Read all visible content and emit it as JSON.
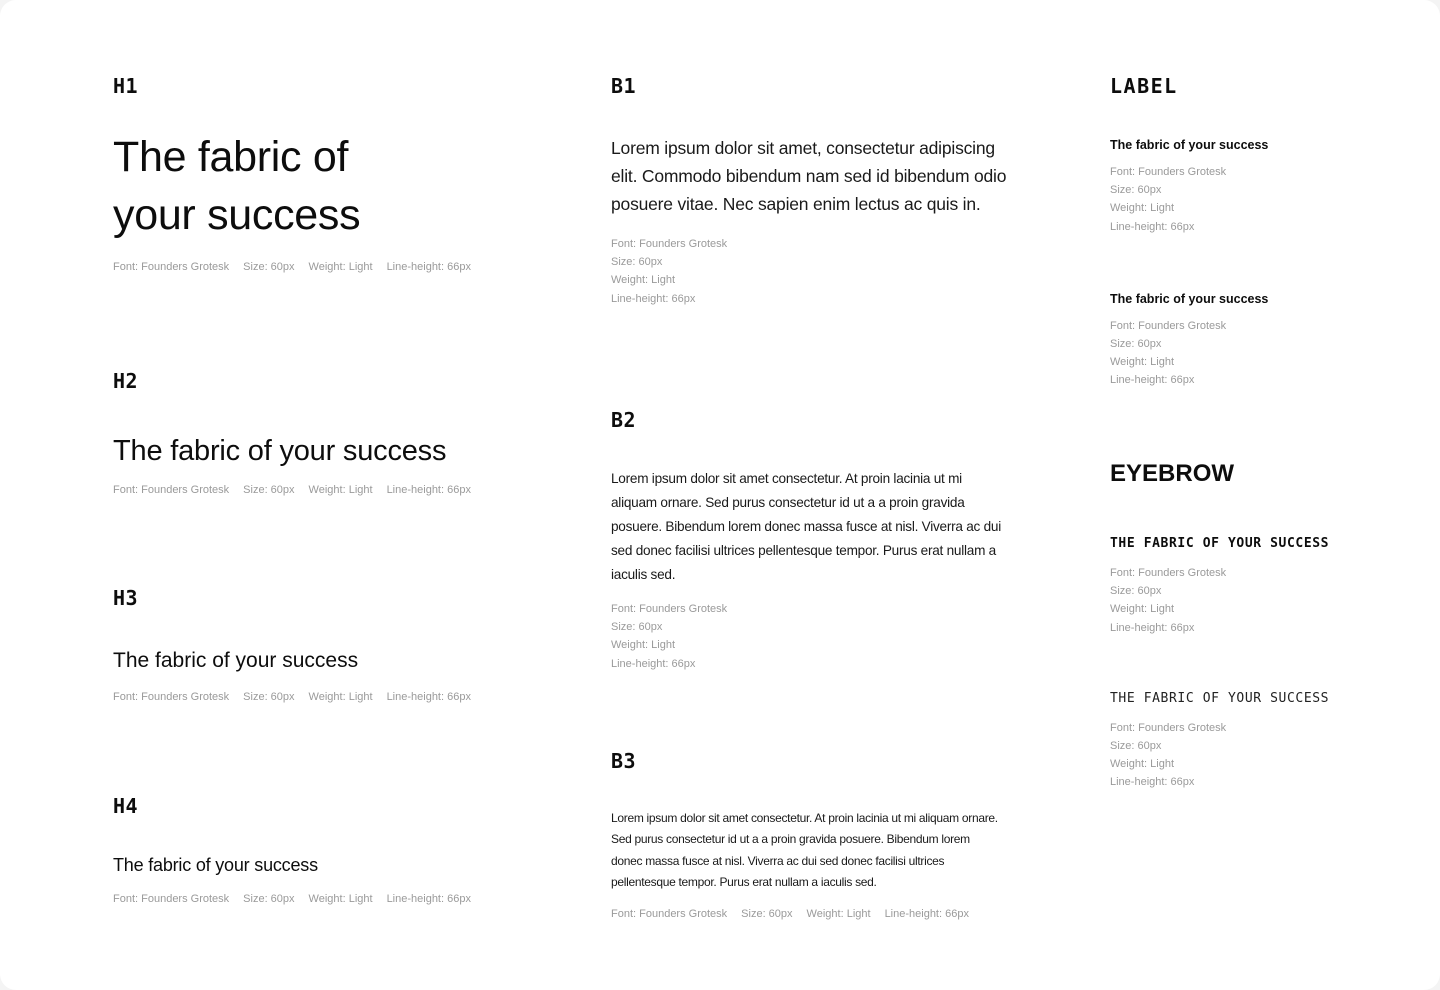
{
  "columns": {
    "headings": {
      "h1": {
        "label": "H1",
        "sample": "The  fabric of your success",
        "meta": [
          "Font:  Founders Grotesk",
          "Size:  60px",
          "Weight:  Light",
          "Line-height:  66px"
        ]
      },
      "h2": {
        "label": "H2",
        "sample": "The  fabric of your success",
        "meta": [
          "Font:  Founders Grotesk",
          "Size:  60px",
          "Weight:  Light",
          "Line-height:  66px"
        ]
      },
      "h3": {
        "label": "H3",
        "sample": "The  fabric of your success",
        "meta": [
          "Font:  Founders Grotesk",
          "Size:  60px",
          "Weight:  Light",
          "Line-height:  66px"
        ]
      },
      "h4": {
        "label": "H4",
        "sample": "The fabric of your success",
        "meta": [
          "Font:  Founders Grotesk",
          "Size:  60px",
          "Weight:  Light",
          "Line-height:  66px"
        ]
      }
    },
    "body": {
      "b1": {
        "label": "B1",
        "sample": "Lorem ipsum dolor sit amet, consectetur adipiscing elit. Commodo bibendum nam sed id bibendum odio posuere vitae. Nec sapien enim lectus ac quis in.",
        "meta": [
          "Font:  Founders Grotesk",
          "Size:  60px",
          "Weight:  Light",
          "Line-height:  66px"
        ]
      },
      "b2": {
        "label": "B2",
        "sample": "Lorem ipsum dolor sit amet consectetur. At proin lacinia ut mi aliquam ornare. Sed purus consectetur id ut a a proin gravida posuere. Bibendum lorem donec massa fusce at nisl. Viverra ac dui sed donec facilisi ultrices pellentesque tempor. Purus erat nullam a iaculis sed.",
        "meta": [
          "Font:  Founders Grotesk",
          "Size:  60px",
          "Weight:  Light",
          "Line-height:  66px"
        ]
      },
      "b3": {
        "label": "B3",
        "sample": "Lorem ipsum dolor sit amet consectetur. At proin lacinia ut mi aliquam ornare. Sed purus consectetur id ut a a proin gravida posuere. Bibendum lorem donec massa fusce at nisl. Viverra ac dui sed donec facilisi ultrices pellentesque tempor. Purus erat nullam a iaculis sed.",
        "meta": [
          "Font:  Founders Grotesk",
          "Size:  60px",
          "Weight:  Light",
          "Line-height:  66px"
        ]
      }
    },
    "label": {
      "title": "LABEL",
      "items": [
        {
          "sample": "The  fabric of your success",
          "meta": [
            "Font:  Founders Grotesk",
            "Size:  60px",
            "Weight:  Light",
            "Line-height:  66px"
          ]
        },
        {
          "sample": "The  fabric of your success",
          "meta": [
            "Font:  Founders Grotesk",
            "Size:  60px",
            "Weight:  Light",
            "Line-height:  66px"
          ]
        }
      ]
    },
    "eyebrow": {
      "title": "EYEBROW",
      "items": [
        {
          "sample": "THE FABRIC OF YOUR SUCCESS",
          "meta": [
            "Font:  Founders Grotesk",
            "Size:  60px",
            "Weight:  Light",
            "Line-height:  66px"
          ]
        },
        {
          "sample": "THE FABRIC OF YOUR SUCCESS",
          "meta": [
            "Font:  Founders Grotesk",
            "Size:  60px",
            "Weight:  Light",
            "Line-height:  66px"
          ]
        }
      ]
    }
  }
}
